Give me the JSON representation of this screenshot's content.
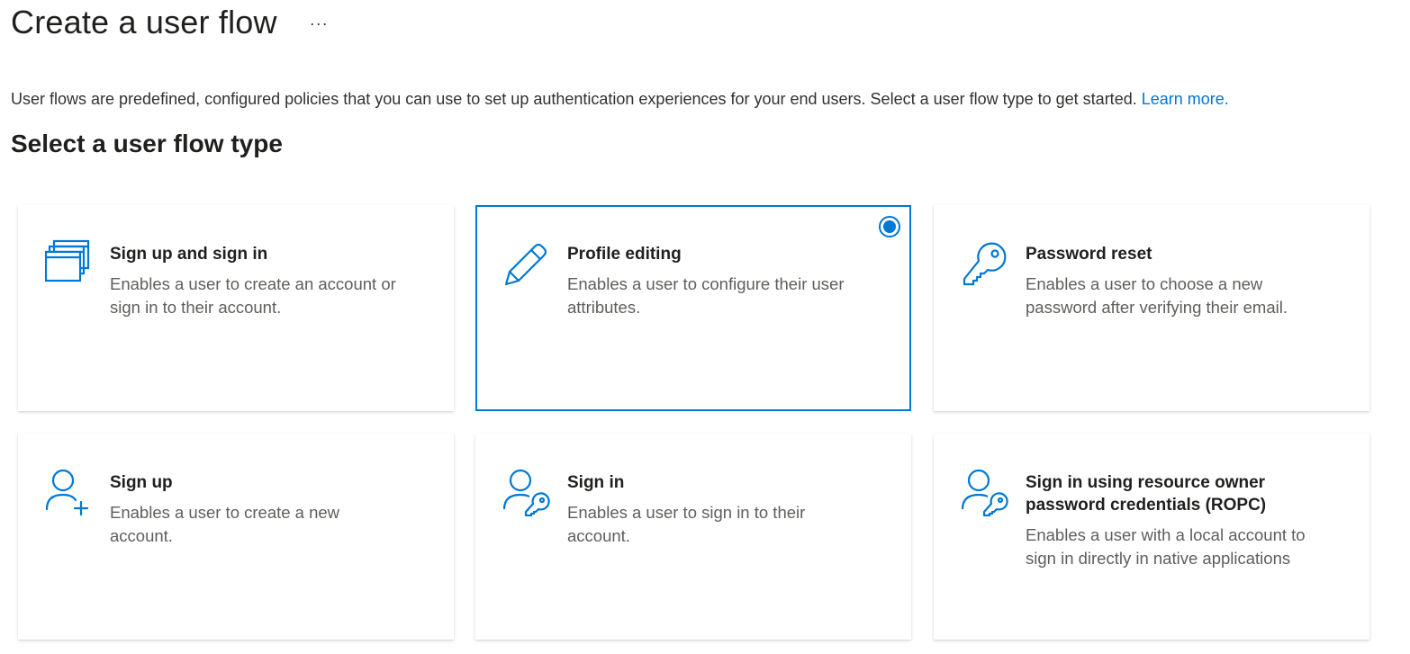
{
  "header": {
    "title": "Create a user flow",
    "more_label": "···"
  },
  "intro": {
    "text": "User flows are predefined, configured policies that you can use to set up authentication experiences for your end users. Select a user flow type to get started. ",
    "link": "Learn more."
  },
  "section": {
    "title": "Select a user flow type"
  },
  "cards": [
    {
      "title": "Sign up and sign in",
      "description": "Enables a user to create an account or sign in to their account.",
      "icon": "windows-stack-icon"
    },
    {
      "title": "Profile editing",
      "description": "Enables a user to configure their user attributes.",
      "icon": "pencil-icon",
      "selected": true
    },
    {
      "title": "Password reset",
      "description": "Enables a user to choose a new password after verifying their email.",
      "icon": "key-icon"
    },
    {
      "title": "Sign up",
      "description": "Enables a user to create a new account.",
      "icon": "person-add-icon"
    },
    {
      "title": "Sign in",
      "description": "Enables a user to sign in to their account.",
      "icon": "person-key-icon"
    },
    {
      "title": "Sign in using resource owner password credentials (ROPC)",
      "description": "Enables a user with a local account to sign in directly in native applications",
      "icon": "person-key-icon"
    }
  ],
  "colors": {
    "accent": "#0078d4",
    "title": "#201f1e",
    "body": "#605e5c"
  }
}
